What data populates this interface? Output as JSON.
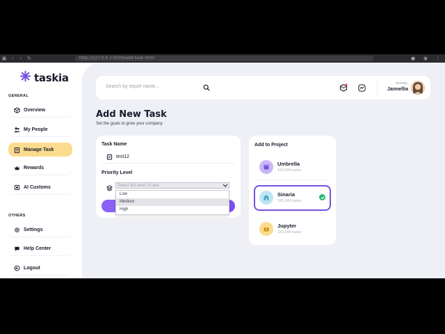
{
  "browser": {
    "url": "http://127.0.0.1:5500/add-task.html"
  },
  "app": {
    "logo_text": "taskia"
  },
  "sidebar": {
    "general_label": "GENERAL",
    "others_label": "OTHERS",
    "items": [
      {
        "label": "Overview",
        "icon": "cube-icon"
      },
      {
        "label": "My People",
        "icon": "people-icon"
      },
      {
        "label": "Manage Task",
        "icon": "task-icon",
        "active": true
      },
      {
        "label": "Rewards",
        "icon": "crown-icon"
      },
      {
        "label": "AI Customs",
        "icon": "ai-icon"
      },
      {
        "label": "Settings",
        "icon": "gear-icon"
      },
      {
        "label": "Help Center",
        "icon": "help-icon"
      },
      {
        "label": "Logout",
        "icon": "logout-icon"
      }
    ]
  },
  "topbar": {
    "search_placeholder": "Search by report name...",
    "greeting": "Howdy,",
    "user_name": "Jannellia"
  },
  "page": {
    "title": "Add New Task",
    "subtitle": "Set the goals to grow your company"
  },
  "task_form": {
    "name_label": "Task Name",
    "name_value": "test12",
    "priority_label": "Priority Level",
    "priority_placeholder": "Select the level of task",
    "priority_options": [
      "Low",
      "Medium",
      "High"
    ],
    "highlighted_option": "Medium"
  },
  "projects": {
    "title": "Add to Project",
    "items": [
      {
        "name": "Umbrella",
        "count": "183,049 tasks",
        "color": "#c9b8f5",
        "selected": false
      },
      {
        "name": "Sinaria",
        "count": "183,049 tasks",
        "color": "#bde6f2",
        "selected": true
      },
      {
        "name": "Jupyter",
        "count": "183,049 tasks",
        "color": "#fbdc8e",
        "selected": false
      }
    ]
  },
  "colors": {
    "accent": "#7452dd",
    "active_nav": "#fbdc8e",
    "success": "#2bb673"
  }
}
